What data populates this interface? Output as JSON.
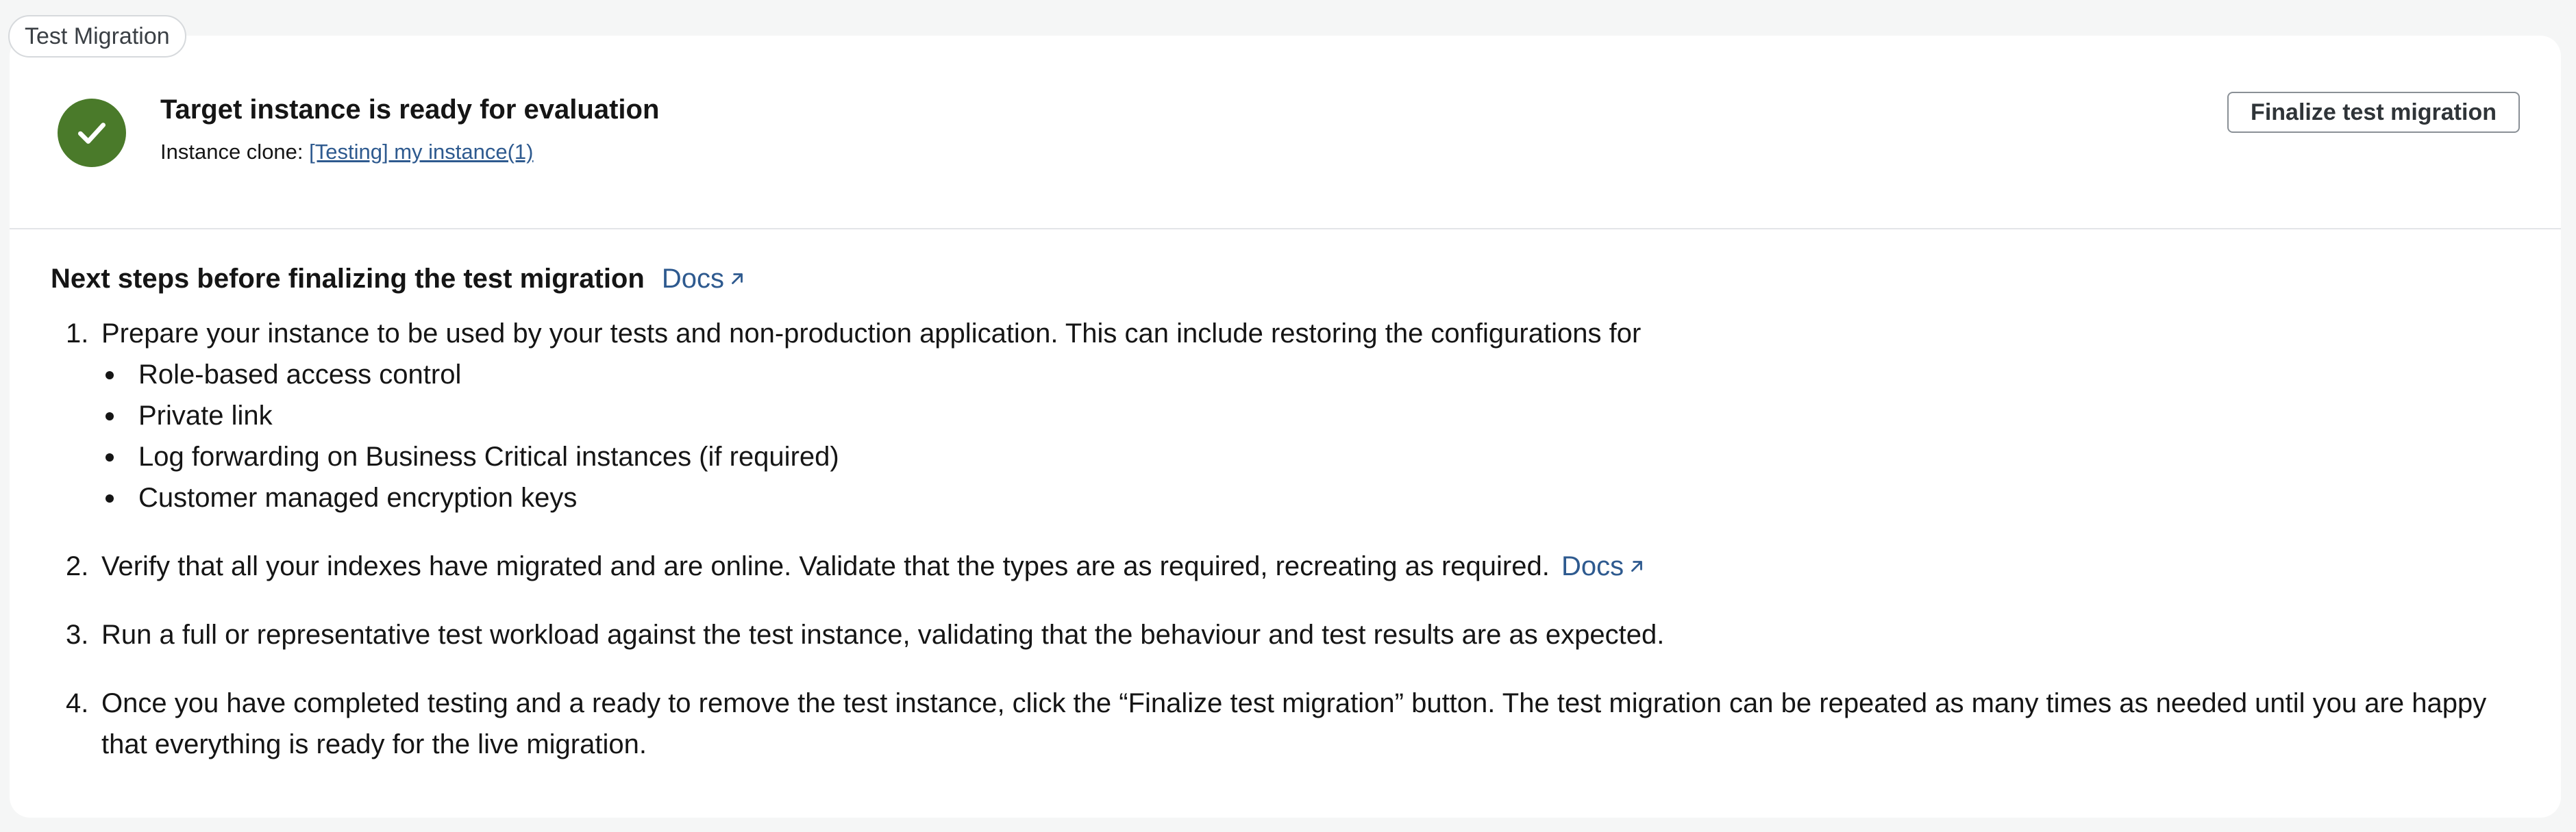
{
  "tab": {
    "label": "Test Migration"
  },
  "status": {
    "title": "Target instance is ready for evaluation",
    "clone_prefix": "Instance clone: ",
    "clone_link": "[Testing] my instance(1)",
    "icon": "check-circle-icon",
    "icon_color": "#4a7a2a"
  },
  "actions": {
    "finalize_label": "Finalize test migration"
  },
  "next_steps": {
    "heading": "Next steps before finalizing the test migration",
    "docs_label": "Docs",
    "steps": [
      {
        "number": "1.",
        "text": "Prepare your instance to be used by your tests and non-production application. This can include restoring the configurations for",
        "bullets": [
          "Role-based access control",
          "Private link",
          "Log forwarding on Business Critical instances (if required)",
          "Customer managed encryption keys"
        ]
      },
      {
        "number": "2.",
        "text": "Verify that all your indexes have migrated and are online. Validate that the types are as required, recreating as required.",
        "docs_label": "Docs"
      },
      {
        "number": "3.",
        "text": "Run a full or representative test workload against the test instance, validating that the behaviour and test results are as expected."
      },
      {
        "number": "4.",
        "text": "Once you have completed testing and a ready to remove the test instance, click the “Finalize test migration” button. The test migration can be repeated as many times as needed until you are happy that everything is ready for the live migration."
      }
    ]
  },
  "colors": {
    "link": "#2e5a8f",
    "success": "#4a7a2a"
  }
}
